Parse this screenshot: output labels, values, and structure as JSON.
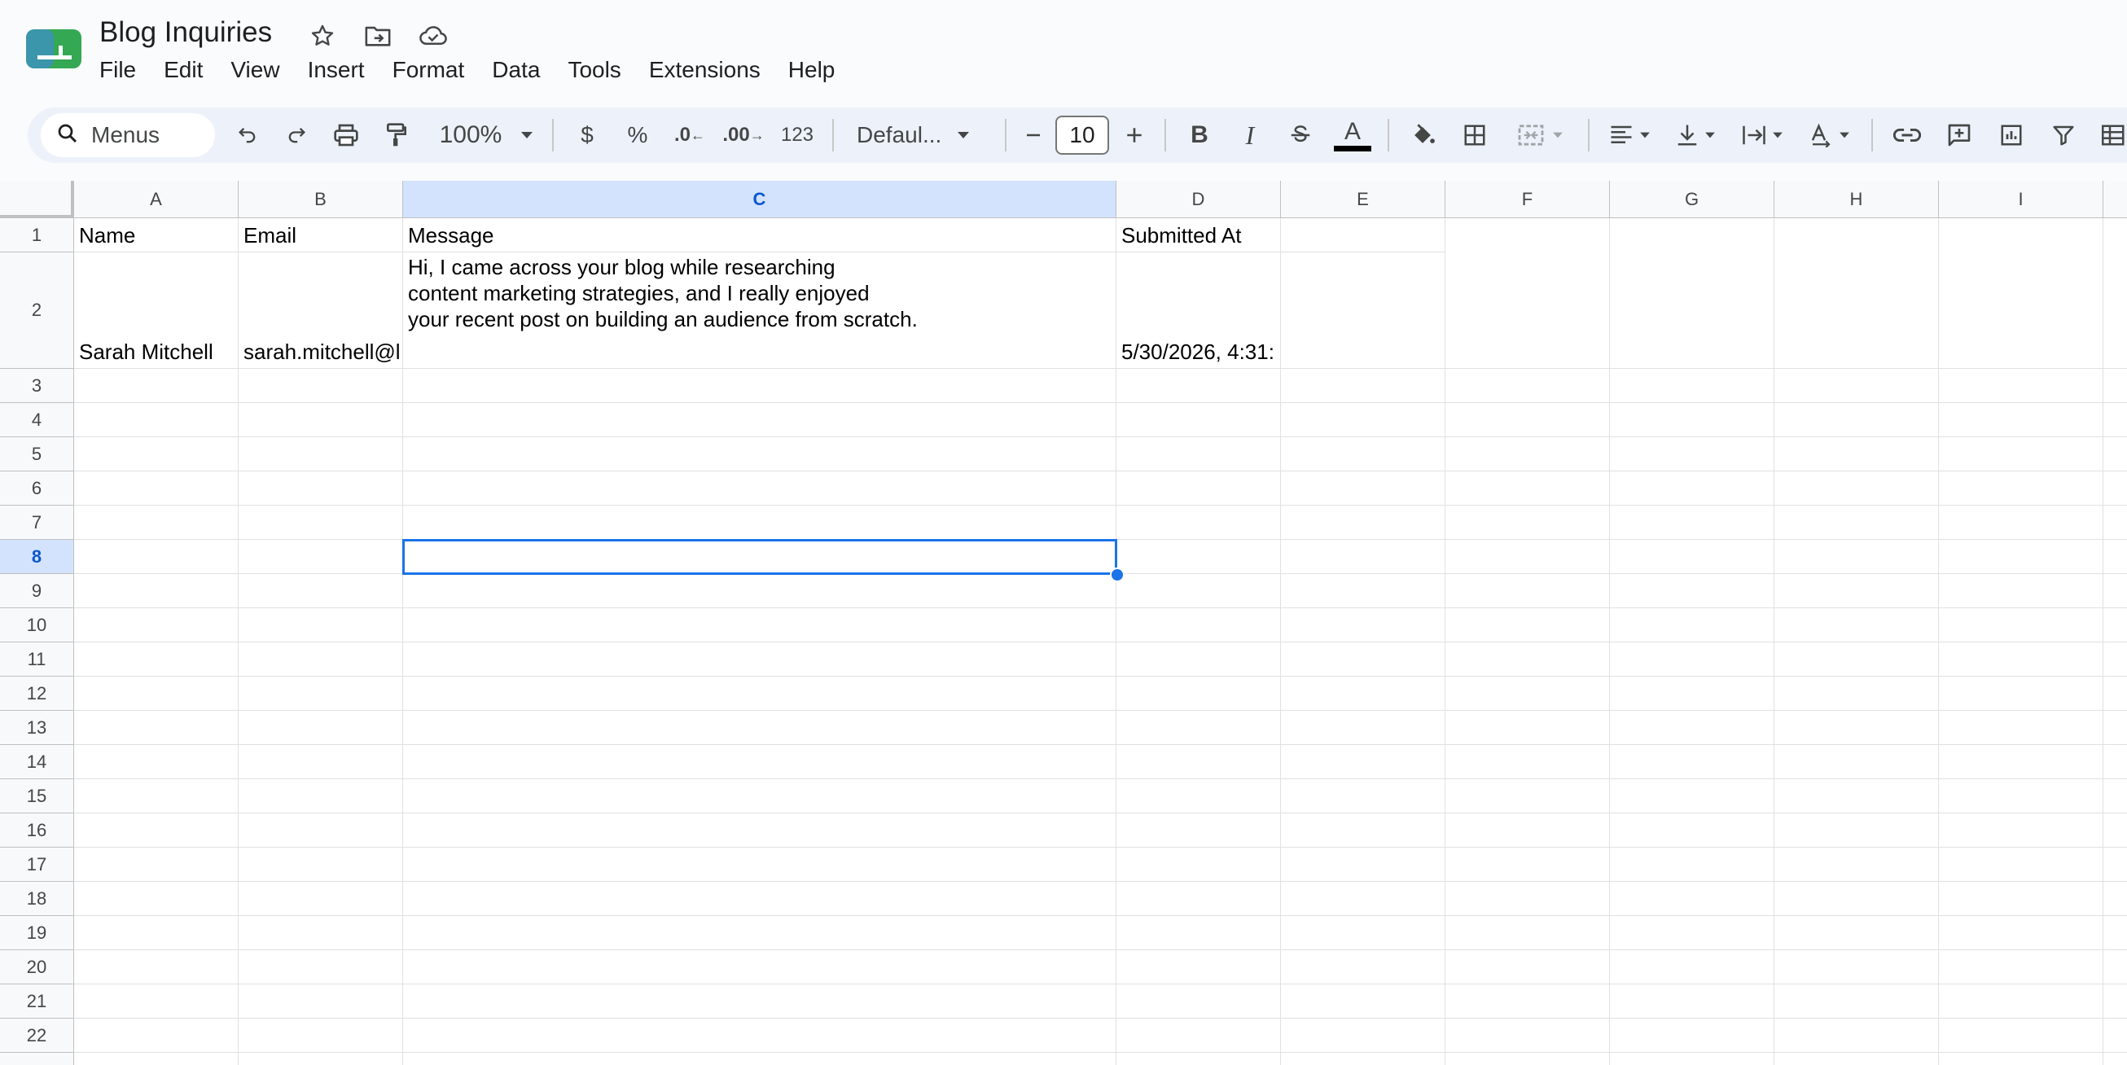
{
  "app": {
    "title": "Blog Inquiries",
    "brand_color": "#0f9d58",
    "title_icons": [
      "star-icon",
      "move-to-folder-icon",
      "cloud-saved-icon"
    ]
  },
  "menu": [
    "File",
    "Edit",
    "View",
    "Insert",
    "Format",
    "Data",
    "Tools",
    "Extensions",
    "Help"
  ],
  "toolbar": {
    "search_placeholder": "Menus",
    "zoom": "100%",
    "currency": "$",
    "percent": "%",
    "decrease_decimal": ".0",
    "increase_decimal": ".00",
    "more_formats": "123",
    "font": "Defaul...",
    "font_size": "10",
    "bold": "B",
    "italic": "I",
    "text_color": "A"
  },
  "sheet": {
    "columns": [
      "A",
      "B",
      "C",
      "D",
      "E",
      "F",
      "G",
      "H",
      "I"
    ],
    "selected_column": "C",
    "rows": [
      "1",
      "2",
      "3",
      "4",
      "5",
      "6",
      "7",
      "8",
      "9",
      "10",
      "11",
      "12",
      "13",
      "14",
      "15",
      "16",
      "17",
      "18",
      "19",
      "20",
      "21",
      "22"
    ],
    "selected_row": "8",
    "header_row": [
      "Name",
      "Email",
      "Message",
      "Submitted At"
    ],
    "data_row": {
      "name": "Sarah Mitchell",
      "email": "sarah.mitchell@l",
      "message_lines": [
        "Hi, I came across your blog while researching",
        "content marketing strategies, and I really enjoyed",
        "your recent post on building an audience from scratch."
      ],
      "submitted_at": "5/30/2026, 4:31:"
    },
    "active_cell": "C8",
    "selection_color": "#1a73e8"
  }
}
